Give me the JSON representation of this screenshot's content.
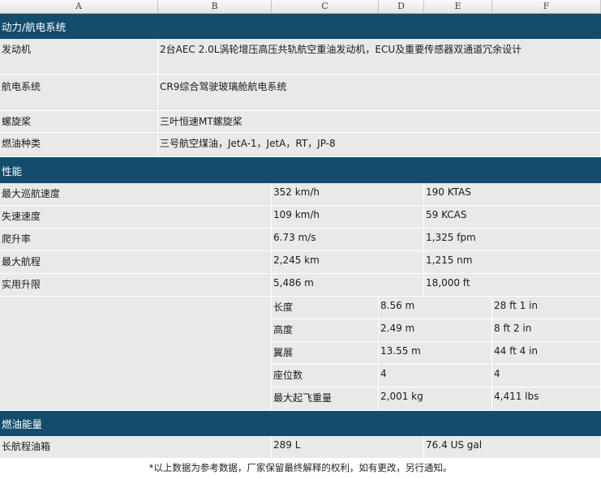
{
  "columns": [
    "A",
    "B",
    "C",
    "D",
    "E",
    "F"
  ],
  "sections": {
    "powerplant": "动力/航电系统",
    "performance": "性能",
    "fuel_capacity": "燃油能量"
  },
  "powerplant_rows": [
    {
      "label": "发动机",
      "value": "2台AEC 2.0L涡轮增压高压共轨航空重油发动机，ECU及重要传感器双通道冗余设计"
    },
    {
      "label": "航电系统",
      "value": "CR9综合驾驶玻璃舱航电系统"
    },
    {
      "label": "螺旋桨",
      "value": "三叶恒速MT螺旋桨"
    },
    {
      "label": "燃油种类",
      "value": "三号航空煤油，JetA-1，JetA，RT，JP-8"
    }
  ],
  "performance_rows": [
    {
      "label": "最大巡航速度",
      "metric": "352 km/h",
      "imperial": "190 KTAS"
    },
    {
      "label": "失速速度",
      "metric": "109 km/h",
      "imperial": "59 KCAS"
    },
    {
      "label": "爬升率",
      "metric": "6.73 m/s",
      "imperial": "1,325 fpm"
    },
    {
      "label": "最大航程",
      "metric": "2,245 km",
      "imperial": "1,215 nm"
    },
    {
      "label": "实用升限",
      "metric": "5,486 m",
      "imperial": "18,000 ft"
    }
  ],
  "dimension_rows": [
    {
      "label": "长度",
      "metric": "8.56 m",
      "imperial": "28 ft 1 in"
    },
    {
      "label": "高度",
      "metric": "2.49 m",
      "imperial": "8 ft 2 in"
    },
    {
      "label": "翼展",
      "metric": "13.55 m",
      "imperial": "44 ft 4 in"
    },
    {
      "label": "座位数",
      "metric": "4",
      "imperial": "4"
    },
    {
      "label": "最大起飞重量",
      "metric": "2,001 kg",
      "imperial": "4,411 lbs"
    }
  ],
  "fuel_rows": [
    {
      "label": "长航程油箱",
      "metric": "289 L",
      "imperial": "76.4 US gal"
    }
  ],
  "footnote": "*以上数据为参考数据，厂家保留最终解释的权利，如有更改，另行通知。",
  "colors": {
    "section_band": "#144c6e",
    "cell_fill": "#e9e9e9"
  }
}
